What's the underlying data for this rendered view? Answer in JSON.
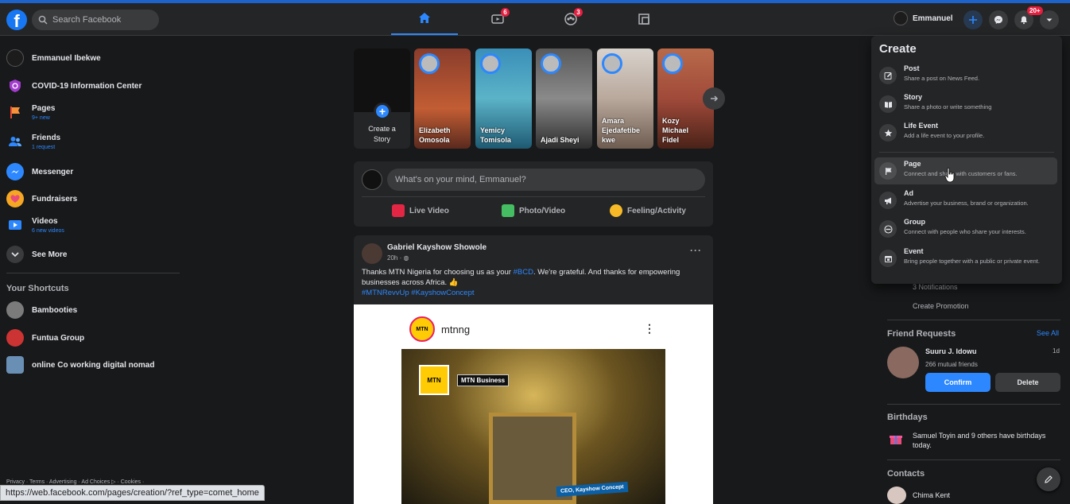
{
  "topbar": {
    "logo_letter": "f",
    "search_placeholder": "Search Facebook",
    "badges": {
      "watch": "6",
      "groups": "3",
      "notifications": "20+"
    },
    "profile_name": "Emmanuel"
  },
  "sidebar": {
    "items": [
      {
        "title": "Emmanuel Ibekwe",
        "sub": ""
      },
      {
        "title": "COVID-19 Information Center",
        "sub": ""
      },
      {
        "title": "Pages",
        "sub": "9+ new"
      },
      {
        "title": "Friends",
        "sub": "1 request"
      },
      {
        "title": "Messenger",
        "sub": ""
      },
      {
        "title": "Fundraisers",
        "sub": ""
      },
      {
        "title": "Videos",
        "sub": "6 new videos"
      },
      {
        "title": "See More",
        "sub": ""
      }
    ],
    "shortcuts_title": "Your Shortcuts",
    "shortcuts": [
      {
        "title": "Bambooties"
      },
      {
        "title": "Funtua Group"
      },
      {
        "title": "online Co working digital nomad"
      }
    ],
    "footer": "Privacy · Terms · Advertising · Ad Choices ▷ · Cookies ·"
  },
  "status_url": "https://web.facebook.com/pages/creation/?ref_type=comet_home",
  "stories": {
    "create_label_1": "Create a",
    "create_label_2": "Story",
    "items": [
      {
        "line1": "Elizabeth",
        "line2": "Omosola",
        "line3": ""
      },
      {
        "line1": "Yemicy",
        "line2": "Tomisola",
        "line3": ""
      },
      {
        "line1": "Ajadi Sheyi",
        "line2": "",
        "line3": ""
      },
      {
        "line1": "Amara",
        "line2": "Ejedafetibe",
        "line3": "kwe"
      },
      {
        "line1": "Kozy",
        "line2": "Michael",
        "line3": "Fidel"
      }
    ]
  },
  "composer": {
    "placeholder": "What's on your mind, Emmanuel?",
    "actions": [
      "Live Video",
      "Photo/Video",
      "Feeling/Activity"
    ]
  },
  "post": {
    "author": "Gabriel Kayshow Showole",
    "time": "20h · ◍",
    "more": "···",
    "text_1": "Thanks MTN Nigeria for choosing us as your ",
    "hashtag_1": "#BCD",
    "text_2": ". We're grateful. And thanks for empowering businesses across Africa. 👍",
    "hashtags_2": "#MTNRevvUp #KayshowConcept",
    "image": {
      "logo_text": "MTN",
      "brand_name": "mtnng",
      "box_text": "MTN",
      "business_label": "MTN Business",
      "ceo_label": "CEO, Kayshow Concept"
    }
  },
  "create_menu": {
    "title": "Create",
    "items": [
      {
        "label": "Post",
        "desc": "Share a post on News Feed."
      },
      {
        "label": "Story",
        "desc": "Share a photo or write something"
      },
      {
        "label": "Life Event",
        "desc": "Add a life event to your profile."
      },
      {
        "label": "Page",
        "desc": "Connect and share with customers or fans."
      },
      {
        "label": "Ad",
        "desc": "Advertise your business, brand or organization."
      },
      {
        "label": "Group",
        "desc": "Connect with people who share your interests."
      },
      {
        "label": "Event",
        "desc": "Bring people together with a public or private event."
      }
    ]
  },
  "right": {
    "notifications_text": "3 Notifications",
    "create_promotion": "Create Promotion",
    "friend_requests_title": "Friend Requests",
    "see_all": "See All",
    "request": {
      "name": "Suuru J. Idowu",
      "mutual": "266 mutual friends",
      "time": "1d"
    },
    "confirm_label": "Confirm",
    "delete_label": "Delete",
    "birthdays_title": "Birthdays",
    "birthday_text": "Samuel Toyin and 9 others have birthdays today.",
    "contacts_title": "Contacts",
    "contact_name": "Chima Kent"
  },
  "colors": {
    "accent": "#2d88ff",
    "background": "#18191a",
    "surface": "#242526",
    "badge": "#e41e3f"
  }
}
